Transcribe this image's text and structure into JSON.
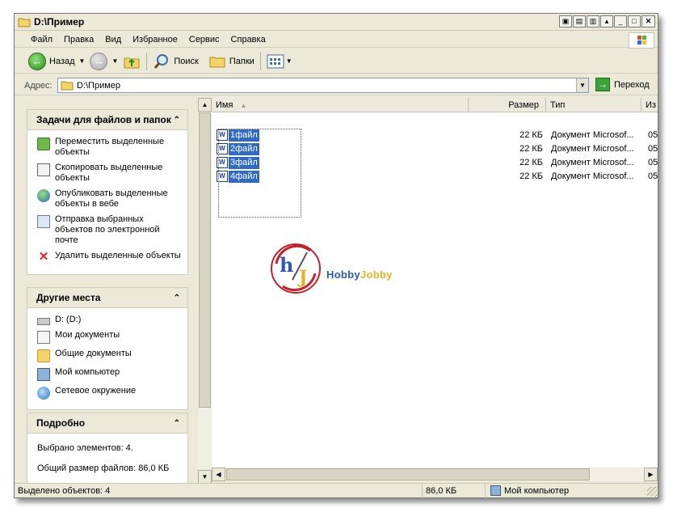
{
  "window": {
    "title": "D:\\Пример"
  },
  "menu": [
    "Файл",
    "Правка",
    "Вид",
    "Избранное",
    "Сервис",
    "Справка"
  ],
  "toolbar": {
    "back": "Назад",
    "search": "Поиск",
    "folders": "Папки"
  },
  "address": {
    "label": "Адрес:",
    "value": "D:\\Пример",
    "go": "Переход"
  },
  "tasks_panel": {
    "title": "Задачи для файлов и папок",
    "items": [
      {
        "label": "Переместить выделенные объекты",
        "icon": "move-icon"
      },
      {
        "label": "Скопировать выделенные объекты",
        "icon": "copy-icon"
      },
      {
        "label": "Опубликовать выделенные объекты в вебе",
        "icon": "web-publish-icon"
      },
      {
        "label": "Отправка выбранных объектов по электронной почте",
        "icon": "email-icon"
      },
      {
        "label": "Удалить выделенные объекты",
        "icon": "delete-icon"
      }
    ]
  },
  "places_panel": {
    "title": "Другие места",
    "items": [
      {
        "label": "D: (D:)",
        "icon": "drive-icon"
      },
      {
        "label": "Мои документы",
        "icon": "documents-icon"
      },
      {
        "label": "Общие документы",
        "icon": "folder-icon"
      },
      {
        "label": "Мой компьютер",
        "icon": "computer-icon"
      },
      {
        "label": "Сетевое окружение",
        "icon": "network-icon"
      }
    ]
  },
  "details_panel": {
    "title": "Подробно",
    "selected": "Выбрано элементов: 4.",
    "total_size": "Общий размер файлов: 86,0 КБ"
  },
  "columns": {
    "name": "Имя",
    "size": "Размер",
    "type": "Тип",
    "modified": "Из"
  },
  "files": [
    {
      "name": "1файл",
      "size": "22 КБ",
      "type": "Документ Microsof...",
      "modified": "05"
    },
    {
      "name": "2файл",
      "size": "22 КБ",
      "type": "Документ Microsof...",
      "modified": "05"
    },
    {
      "name": "3файл",
      "size": "22 КБ",
      "type": "Документ Microsof...",
      "modified": "05"
    },
    {
      "name": "4файл",
      "size": "22 КБ",
      "type": "Документ Microsof...",
      "modified": "05"
    }
  ],
  "watermark": {
    "part1": "Hobby",
    "part2": "Jobby"
  },
  "status": {
    "selected": "Выделено объектов: 4",
    "size": "86,0 КБ",
    "location": "Мой компьютер"
  },
  "colors": {
    "selection": "#316ac5",
    "chrome": "#ece9d8"
  }
}
